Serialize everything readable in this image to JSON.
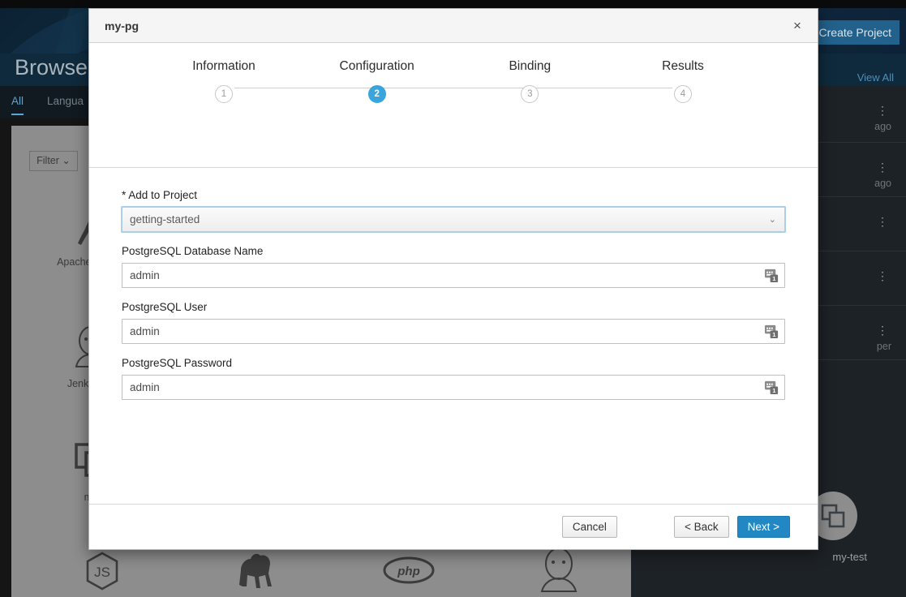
{
  "background": {
    "create_project_button": "Create Project",
    "page_title": "Browse C",
    "view_all_link": "View All",
    "tabs": [
      {
        "label": "All",
        "active": true
      },
      {
        "label": "Langua",
        "active": false
      }
    ],
    "filter_button": "Filter",
    "filter_caret": "⌄",
    "catalog_items": [
      {
        "name": "apache-httpd-icon",
        "label": "Apache HT\n(htt"
      },
      {
        "name": "jenkins-icon",
        "label": "Jenkins (E"
      },
      {
        "name": "copy-stack-icon",
        "label": "my"
      },
      {
        "name": "nodejs-icon",
        "label": ""
      },
      {
        "name": "perl-camel-icon",
        "label": ""
      },
      {
        "name": "php-icon",
        "label": ""
      },
      {
        "name": "jenkins-icon-2",
        "label": ""
      }
    ],
    "rail_rows": [
      {
        "meta": "ago"
      },
      {
        "meta": "ago"
      },
      {
        "meta": ""
      },
      {
        "meta": ""
      },
      {
        "meta": "per"
      }
    ],
    "rail_kebab": "⋮",
    "rail_project_name": "my-test"
  },
  "modal": {
    "title": "my-pg",
    "close_label": "×",
    "steps": [
      {
        "label": "Information",
        "number": "1",
        "active": false
      },
      {
        "label": "Configuration",
        "number": "2",
        "active": true
      },
      {
        "label": "Binding",
        "number": "3",
        "active": false
      },
      {
        "label": "Results",
        "number": "4",
        "active": false
      }
    ],
    "fields": {
      "add_to_project": {
        "label": "* Add to Project",
        "value": "getting-started",
        "options": [
          "getting-started"
        ],
        "caret": "⌄"
      },
      "db_name": {
        "label": "PostgreSQL Database Name",
        "value": "admin",
        "placeholder": ""
      },
      "db_user": {
        "label": "PostgreSQL User",
        "value": "admin",
        "placeholder": ""
      },
      "db_password": {
        "label": "PostgreSQL Password",
        "value": "admin",
        "placeholder": ""
      }
    },
    "footer": {
      "cancel": "Cancel",
      "back": "< Back",
      "next": "Next >"
    }
  },
  "colors": {
    "accent_blue": "#39a5dc",
    "primary_button": "#2288c4",
    "modal_header_bg": "#f5f5f5",
    "rail_bg": "#1d2226",
    "catalog_overlay": "#8d8d8d",
    "hero_bg": "#123049"
  }
}
